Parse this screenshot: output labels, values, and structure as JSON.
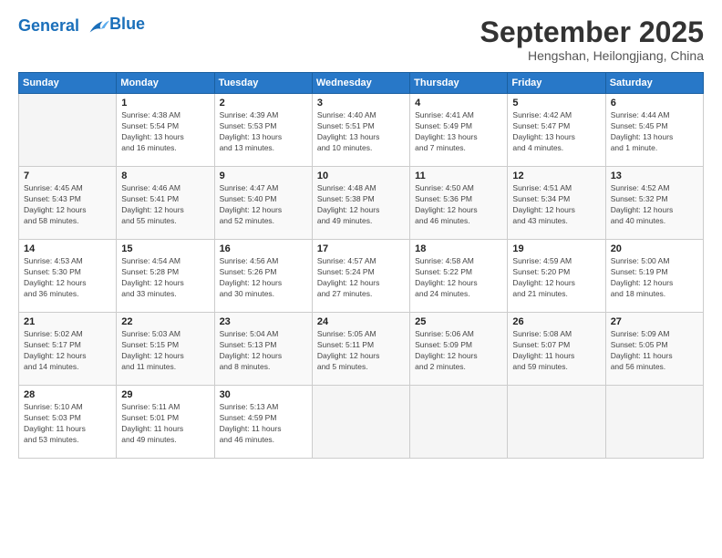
{
  "header": {
    "logo_line1": "General",
    "logo_line2": "Blue",
    "month": "September 2025",
    "location": "Hengshan, Heilongjiang, China"
  },
  "weekdays": [
    "Sunday",
    "Monday",
    "Tuesday",
    "Wednesday",
    "Thursday",
    "Friday",
    "Saturday"
  ],
  "weeks": [
    [
      {
        "day": "",
        "info": ""
      },
      {
        "day": "1",
        "info": "Sunrise: 4:38 AM\nSunset: 5:54 PM\nDaylight: 13 hours\nand 16 minutes."
      },
      {
        "day": "2",
        "info": "Sunrise: 4:39 AM\nSunset: 5:53 PM\nDaylight: 13 hours\nand 13 minutes."
      },
      {
        "day": "3",
        "info": "Sunrise: 4:40 AM\nSunset: 5:51 PM\nDaylight: 13 hours\nand 10 minutes."
      },
      {
        "day": "4",
        "info": "Sunrise: 4:41 AM\nSunset: 5:49 PM\nDaylight: 13 hours\nand 7 minutes."
      },
      {
        "day": "5",
        "info": "Sunrise: 4:42 AM\nSunset: 5:47 PM\nDaylight: 13 hours\nand 4 minutes."
      },
      {
        "day": "6",
        "info": "Sunrise: 4:44 AM\nSunset: 5:45 PM\nDaylight: 13 hours\nand 1 minute."
      }
    ],
    [
      {
        "day": "7",
        "info": "Sunrise: 4:45 AM\nSunset: 5:43 PM\nDaylight: 12 hours\nand 58 minutes."
      },
      {
        "day": "8",
        "info": "Sunrise: 4:46 AM\nSunset: 5:41 PM\nDaylight: 12 hours\nand 55 minutes."
      },
      {
        "day": "9",
        "info": "Sunrise: 4:47 AM\nSunset: 5:40 PM\nDaylight: 12 hours\nand 52 minutes."
      },
      {
        "day": "10",
        "info": "Sunrise: 4:48 AM\nSunset: 5:38 PM\nDaylight: 12 hours\nand 49 minutes."
      },
      {
        "day": "11",
        "info": "Sunrise: 4:50 AM\nSunset: 5:36 PM\nDaylight: 12 hours\nand 46 minutes."
      },
      {
        "day": "12",
        "info": "Sunrise: 4:51 AM\nSunset: 5:34 PM\nDaylight: 12 hours\nand 43 minutes."
      },
      {
        "day": "13",
        "info": "Sunrise: 4:52 AM\nSunset: 5:32 PM\nDaylight: 12 hours\nand 40 minutes."
      }
    ],
    [
      {
        "day": "14",
        "info": "Sunrise: 4:53 AM\nSunset: 5:30 PM\nDaylight: 12 hours\nand 36 minutes."
      },
      {
        "day": "15",
        "info": "Sunrise: 4:54 AM\nSunset: 5:28 PM\nDaylight: 12 hours\nand 33 minutes."
      },
      {
        "day": "16",
        "info": "Sunrise: 4:56 AM\nSunset: 5:26 PM\nDaylight: 12 hours\nand 30 minutes."
      },
      {
        "day": "17",
        "info": "Sunrise: 4:57 AM\nSunset: 5:24 PM\nDaylight: 12 hours\nand 27 minutes."
      },
      {
        "day": "18",
        "info": "Sunrise: 4:58 AM\nSunset: 5:22 PM\nDaylight: 12 hours\nand 24 minutes."
      },
      {
        "day": "19",
        "info": "Sunrise: 4:59 AM\nSunset: 5:20 PM\nDaylight: 12 hours\nand 21 minutes."
      },
      {
        "day": "20",
        "info": "Sunrise: 5:00 AM\nSunset: 5:19 PM\nDaylight: 12 hours\nand 18 minutes."
      }
    ],
    [
      {
        "day": "21",
        "info": "Sunrise: 5:02 AM\nSunset: 5:17 PM\nDaylight: 12 hours\nand 14 minutes."
      },
      {
        "day": "22",
        "info": "Sunrise: 5:03 AM\nSunset: 5:15 PM\nDaylight: 12 hours\nand 11 minutes."
      },
      {
        "day": "23",
        "info": "Sunrise: 5:04 AM\nSunset: 5:13 PM\nDaylight: 12 hours\nand 8 minutes."
      },
      {
        "day": "24",
        "info": "Sunrise: 5:05 AM\nSunset: 5:11 PM\nDaylight: 12 hours\nand 5 minutes."
      },
      {
        "day": "25",
        "info": "Sunrise: 5:06 AM\nSunset: 5:09 PM\nDaylight: 12 hours\nand 2 minutes."
      },
      {
        "day": "26",
        "info": "Sunrise: 5:08 AM\nSunset: 5:07 PM\nDaylight: 11 hours\nand 59 minutes."
      },
      {
        "day": "27",
        "info": "Sunrise: 5:09 AM\nSunset: 5:05 PM\nDaylight: 11 hours\nand 56 minutes."
      }
    ],
    [
      {
        "day": "28",
        "info": "Sunrise: 5:10 AM\nSunset: 5:03 PM\nDaylight: 11 hours\nand 53 minutes."
      },
      {
        "day": "29",
        "info": "Sunrise: 5:11 AM\nSunset: 5:01 PM\nDaylight: 11 hours\nand 49 minutes."
      },
      {
        "day": "30",
        "info": "Sunrise: 5:13 AM\nSunset: 4:59 PM\nDaylight: 11 hours\nand 46 minutes."
      },
      {
        "day": "",
        "info": ""
      },
      {
        "day": "",
        "info": ""
      },
      {
        "day": "",
        "info": ""
      },
      {
        "day": "",
        "info": ""
      }
    ]
  ]
}
